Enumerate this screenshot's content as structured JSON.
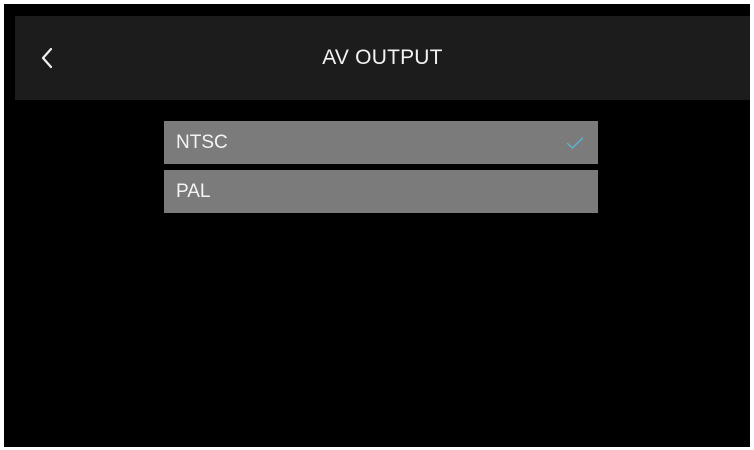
{
  "header": {
    "title": "AV OUTPUT",
    "back_icon": "chevron-left-icon"
  },
  "options": [
    {
      "label": "NTSC",
      "selected": true
    },
    {
      "label": "PAL",
      "selected": false
    }
  ],
  "colors": {
    "background": "#000000",
    "header_background": "#1c1c1c",
    "option_background": "#7b7b7b",
    "check_color": "#5ab4d6",
    "text": "#f2f2f2"
  },
  "icons": {
    "selected_marker": "checkmark-icon"
  }
}
